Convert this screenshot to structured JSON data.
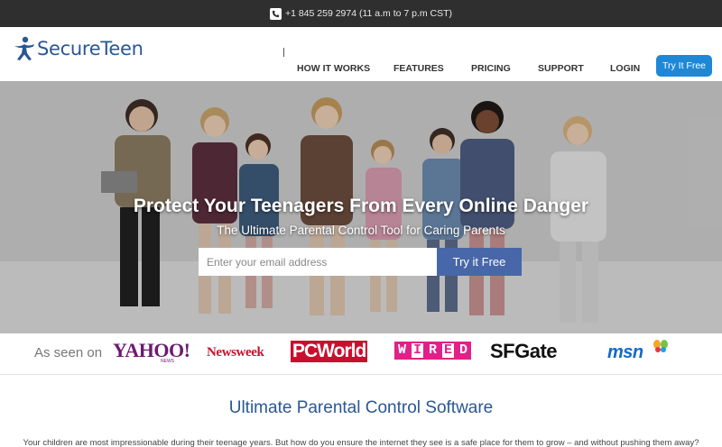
{
  "topbar": {
    "phone_icon": "phone-icon",
    "phone_text": "+1 845 259 2974 (11 a.m to 7 p.m CST)"
  },
  "header": {
    "logo_text": "SecureTeen",
    "nav": [
      "HOW IT WORKS",
      "FEATURES",
      "PRICING",
      "SUPPORT",
      "LOGIN"
    ],
    "cta_label": "Try It Free"
  },
  "hero": {
    "title": "Protect Your Teenagers From Every Online Danger",
    "subtitle": "The Ultimate Parental Control Tool for Caring Parents",
    "email_placeholder": "Enter your email address",
    "cta_label": "Try it Free"
  },
  "as_seen_on": {
    "label": "As seen on",
    "brands": [
      "YAHOO!",
      "Newsweek",
      "PCWorld",
      "WIRED",
      "SFGate",
      "msn"
    ],
    "yahoo_sub": "NEWS"
  },
  "section": {
    "title": "Ultimate Parental Control Software",
    "text": "Your children are most impressionable during their teenage years. But how do you ensure the internet they see is a safe place for them to grow – and without pushing them away?"
  },
  "colors": {
    "topbar_bg": "#2f2f2f",
    "brand_blue": "#2a5795",
    "cta_blue": "#1e88d6",
    "hero_button": "#4867a8"
  }
}
